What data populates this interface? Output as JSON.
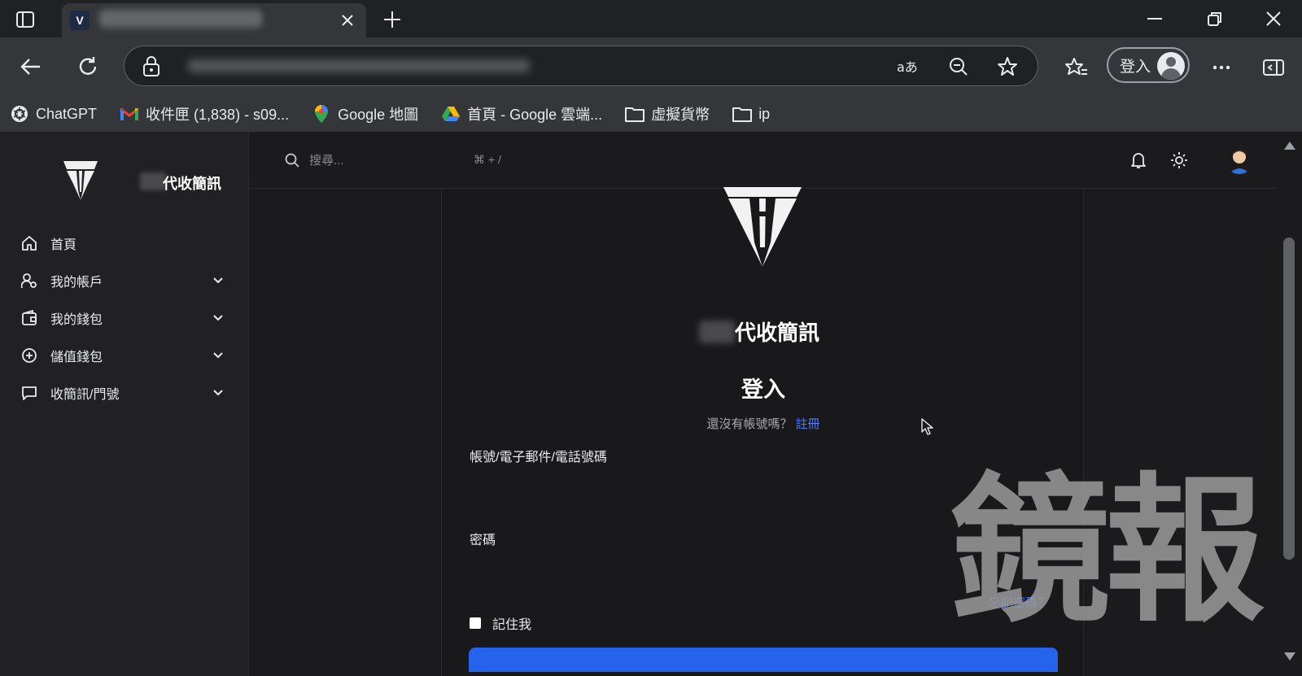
{
  "browser": {
    "signin_label": "登入",
    "bookmarks": [
      {
        "label": "ChatGPT",
        "icon": "chatgpt-icon"
      },
      {
        "label": "收件匣 (1,838) - s09...",
        "icon": "gmail-icon"
      },
      {
        "label": "Google 地圖",
        "icon": "google-maps-icon"
      },
      {
        "label": "首頁 - Google 雲端...",
        "icon": "google-drive-icon"
      },
      {
        "label": "虛擬貨幣",
        "icon": "folder-icon"
      },
      {
        "label": "ip",
        "icon": "folder-icon"
      }
    ]
  },
  "sidebar": {
    "brand_suffix": "代收簡訊",
    "items": [
      {
        "label": "首頁",
        "icon": "home-icon",
        "has_children": false
      },
      {
        "label": "我的帳戶",
        "icon": "user-settings-icon",
        "has_children": true
      },
      {
        "label": "我的錢包",
        "icon": "wallet-icon",
        "has_children": true
      },
      {
        "label": "儲值錢包",
        "icon": "plus-circle-icon",
        "has_children": true
      },
      {
        "label": "收簡訊/門號",
        "icon": "message-icon",
        "has_children": true
      }
    ]
  },
  "topbar": {
    "search_placeholder": "搜尋...",
    "shortcut": "⌘ + /"
  },
  "login": {
    "site_suffix": "代收簡訊",
    "title": "登入",
    "no_account_text": "還沒有帳號嗎？",
    "register_link": "註冊",
    "account_label": "帳號/電子郵件/電話號碼",
    "password_label": "密碼",
    "forgot_link": "忘記密碼？",
    "remember_label": "記住我"
  },
  "watermark": "鏡報",
  "colors": {
    "accent": "#2563eb",
    "link": "#4f7cff",
    "background": "#1b1b1d"
  }
}
